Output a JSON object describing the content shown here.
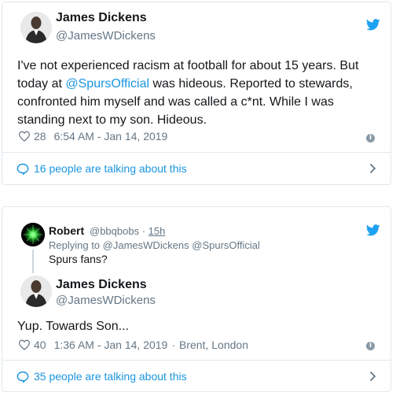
{
  "tweet1": {
    "name": "James Dickens",
    "handle": "@JamesWDickens",
    "text_before": "I've not experienced racism at football for about 15 years. But today at ",
    "mention": "@SpursOfficial",
    "text_after": " was hideous. Reported to stewards, confronted him myself and was called a c*nt. While I was standing next to my son. Hideous.",
    "likes": "28",
    "timestamp": "6:54 AM - Jan 14, 2019",
    "talking": "16 people are talking about this"
  },
  "tweet2": {
    "parent": {
      "name": "Robert",
      "handle": "@bbqbobs",
      "dot": "·",
      "time": "15h",
      "replying_prefix": "Replying to",
      "replying_to": "@JamesWDickens @SpursOfficial",
      "text": "Spurs fans?"
    },
    "name": "James Dickens",
    "handle": "@JamesWDickens",
    "text": "Yup. Towards Son...",
    "likes": "40",
    "timestamp": "1:36 AM - Jan 14, 2019",
    "location_sep": "·",
    "location": "Brent, London",
    "talking": "35 people are talking about this"
  },
  "colors": {
    "twitter_blue": "#1da1f2",
    "link_blue": "#1b95e0",
    "gray_text": "#657786",
    "border": "#e1e8ed"
  },
  "icons": [
    "avatar-man",
    "twitter-bird-icon",
    "heart-icon",
    "info-icon",
    "speech-bubble-icon",
    "chevron-right-icon",
    "avatar-green-orb"
  ]
}
